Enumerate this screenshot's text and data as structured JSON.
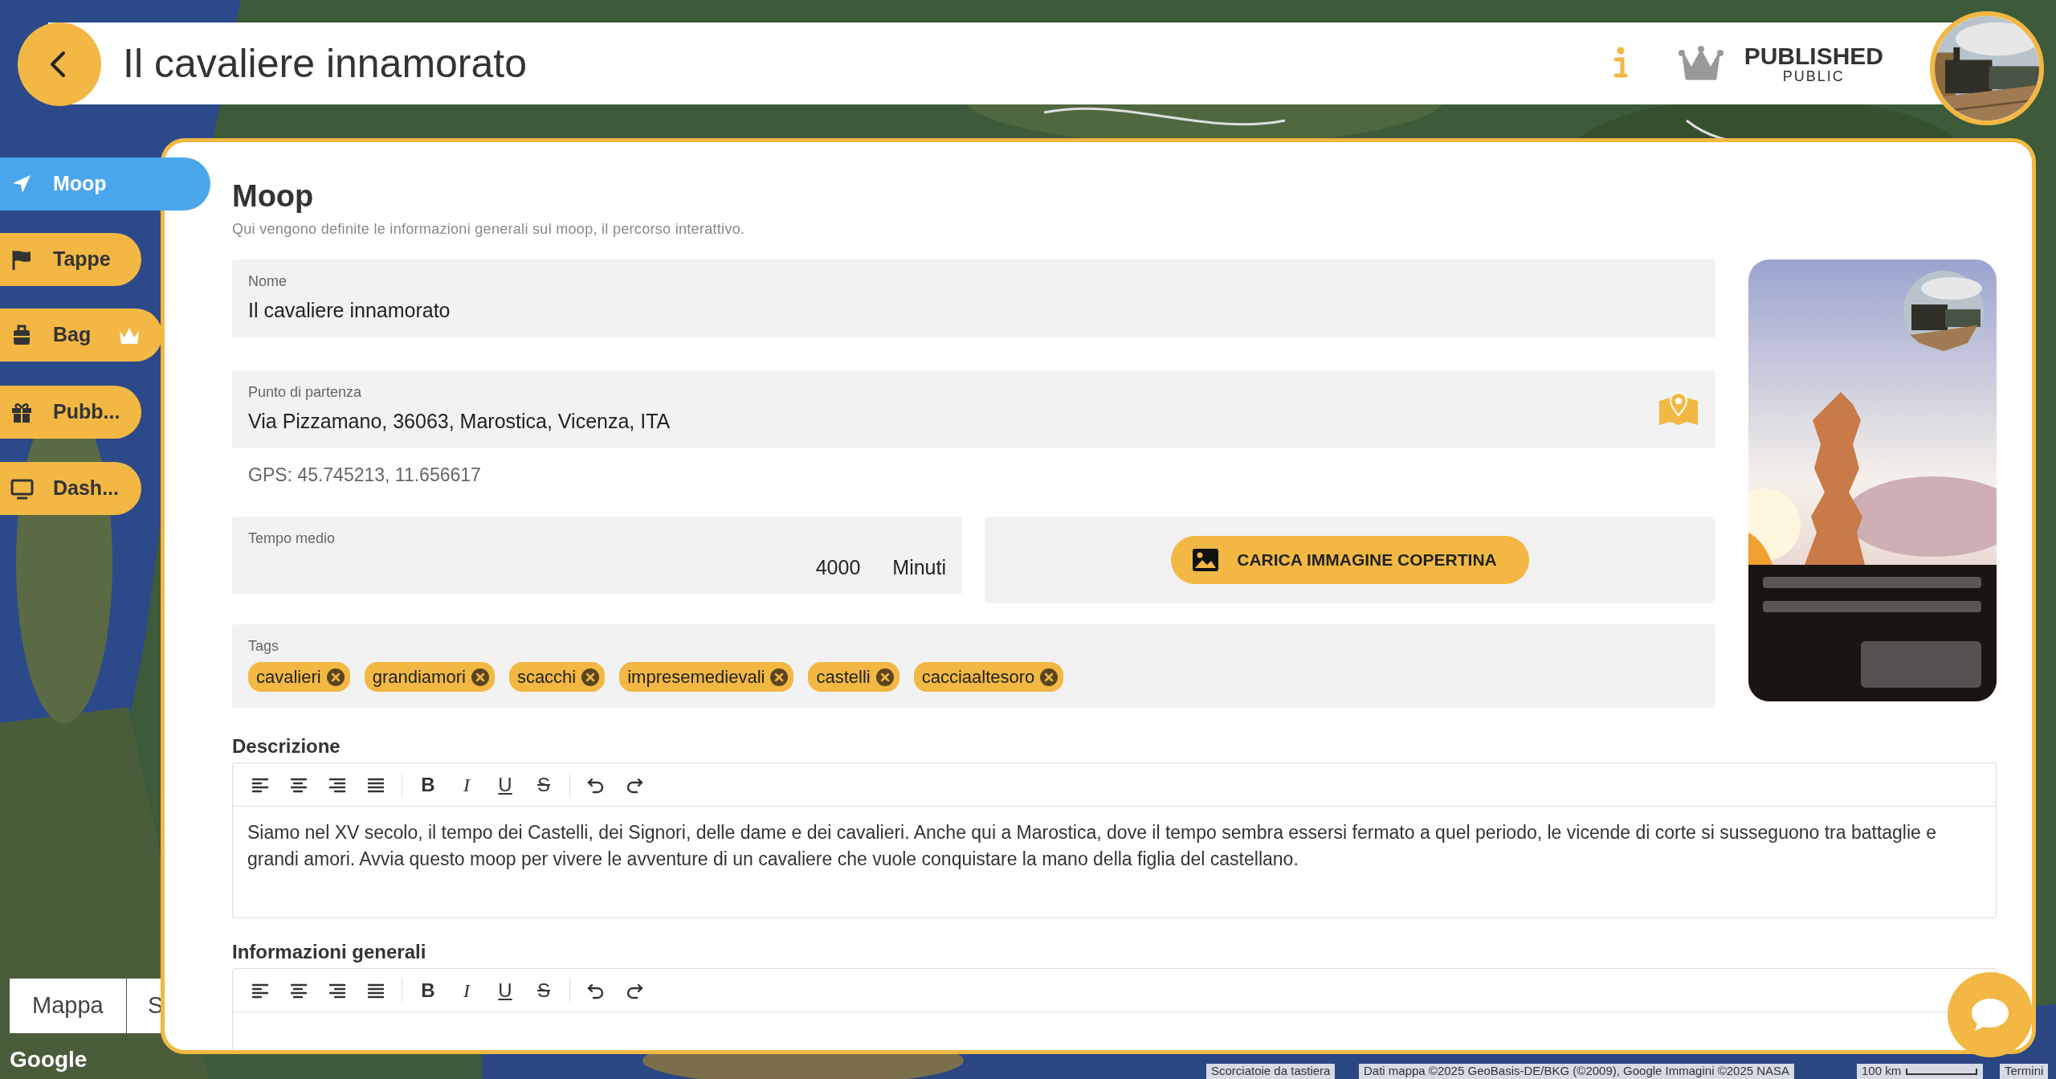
{
  "header": {
    "title": "Il cavaliere innamorato",
    "status": "PUBLISHED",
    "visibility": "PUBLIC"
  },
  "sidebar": {
    "items": [
      {
        "label": "Moop",
        "selected": true,
        "premium": false
      },
      {
        "label": "Tappe",
        "selected": false,
        "premium": false
      },
      {
        "label": "Bag",
        "selected": false,
        "premium": true
      },
      {
        "label": "Pubb...",
        "selected": false,
        "premium": false
      },
      {
        "label": "Dash...",
        "selected": false,
        "premium": false
      }
    ]
  },
  "panel": {
    "title": "Moop",
    "subtitle": "Qui vengono definite le informazioni generali sul moop, il percorso interattivo."
  },
  "name_field": {
    "label": "Nome",
    "value": "Il cavaliere innamorato"
  },
  "start_field": {
    "label": "Punto di partenza",
    "value": "Via Pizzamano, 36063, Marostica, Vicenza, ITA",
    "gps": "GPS: 45.745213, 11.656617"
  },
  "time_field": {
    "label": "Tempo medio",
    "value": "4000",
    "unit": "Minuti"
  },
  "upload_button": "CARICA IMMAGINE COPERTINA",
  "tags": {
    "label": "Tags",
    "items": [
      "cavalieri",
      "grandiamori",
      "scacchi",
      "impresemedievali",
      "castelli",
      "cacciaaltesoro"
    ]
  },
  "editors": [
    {
      "label": "Descrizione",
      "toolbar": [
        {
          "kind": "align-left"
        },
        {
          "kind": "align-center"
        },
        {
          "kind": "align-right"
        },
        {
          "kind": "align-justify"
        },
        {
          "kind": "bold",
          "label": "B"
        },
        {
          "kind": "italic",
          "label": "I"
        },
        {
          "kind": "underline",
          "label": "U"
        },
        {
          "kind": "strike",
          "label": "S"
        },
        {
          "kind": "undo"
        },
        {
          "kind": "redo"
        }
      ],
      "text": "Siamo nel XV secolo, il tempo dei Castelli, dei Signori, delle dame e dei cavalieri. Anche qui a Marostica, dove il tempo sembra essersi fermato a quel periodo, le vicende di corte si susseguono tra battaglie e grandi amori. Avvia questo moop per vivere le avventure di un cavaliere che vuole conquistare la mano della figlia del castellano."
    },
    {
      "label": "Informazioni generali",
      "toolbar": [
        {
          "kind": "align-left"
        },
        {
          "kind": "align-center"
        },
        {
          "kind": "align-right"
        },
        {
          "kind": "align-justify"
        },
        {
          "kind": "bold",
          "label": "B"
        },
        {
          "kind": "italic",
          "label": "I"
        },
        {
          "kind": "underline",
          "label": "U"
        },
        {
          "kind": "strike",
          "label": "S"
        },
        {
          "kind": "undo"
        },
        {
          "kind": "redo"
        }
      ]
    }
  ],
  "map_controls": {
    "map_types": [
      "Mappa",
      "S"
    ],
    "logo": "Google",
    "shortcuts": "Scorciatoie da tastiera",
    "attribution": "Dati mappa ©2025 GeoBasis-DE/BKG (©2009), Google Immagini ©2025 NASA",
    "scale": "100 km",
    "terms": "Termini"
  }
}
